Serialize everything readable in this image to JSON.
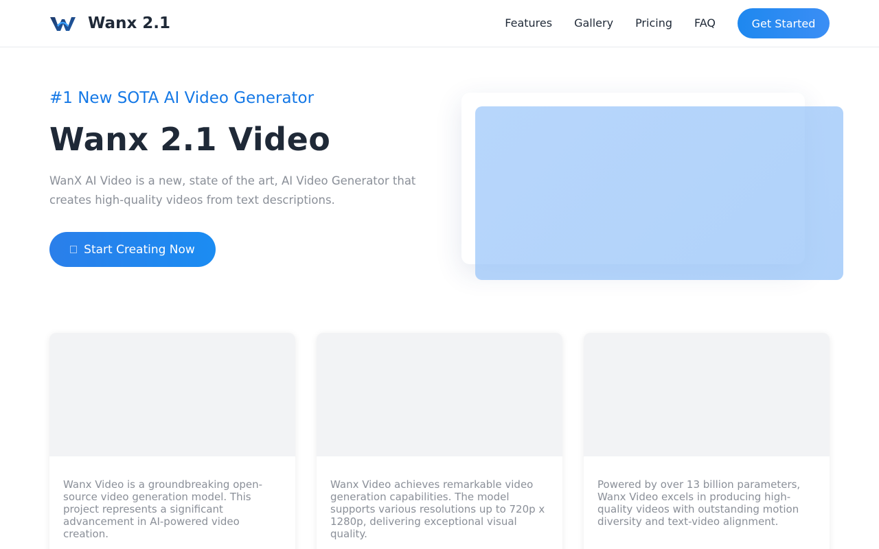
{
  "brand": {
    "name": "Wanx 2.1",
    "icon": "wanx-logo-icon"
  },
  "nav": {
    "links": [
      "Features",
      "Gallery",
      "Pricing",
      "FAQ"
    ],
    "cta": "Get Started"
  },
  "hero": {
    "eyebrow": "#1 New SOTA AI Video Generator",
    "title": "Wanx 2.1 Video",
    "description": "WanX AI Video is a new, state of the art, AI Video Generator that creates high-quality videos from text descriptions.",
    "button": "Start Creating Now",
    "button_icon": "play-icon"
  },
  "cards": [
    {
      "text": "Wanx Video is a groundbreaking open-source video generation model. This project represents a significant advancement in AI-powered video creation."
    },
    {
      "text": "Wanx Video achieves remarkable video generation capabilities. The model supports various resolutions up to 720p x 1280p, delivering exceptional visual quality."
    },
    {
      "text": "Powered by over 13 billion parameters, Wanx Video excels in producing high-quality videos with outstanding motion diversity and text-video alignment."
    }
  ],
  "colors": {
    "accent": "#1478e6",
    "button": "#1e88ef",
    "text": "#1f2937",
    "muted": "#8a8f98"
  }
}
